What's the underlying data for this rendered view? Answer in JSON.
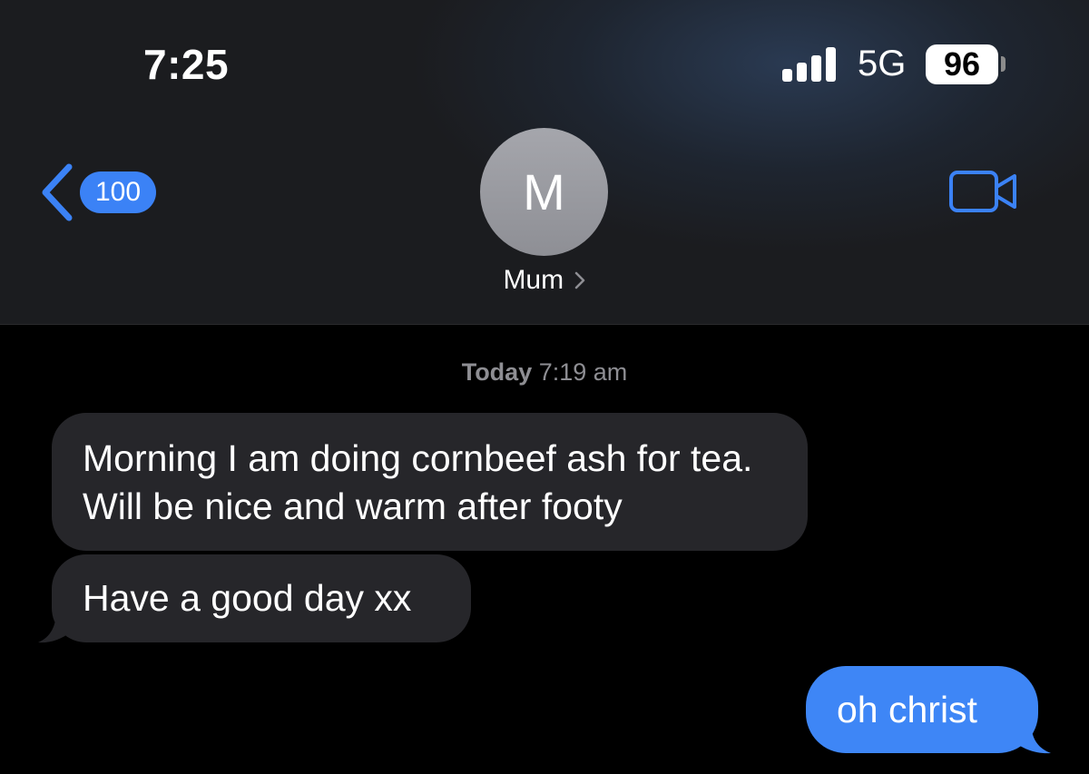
{
  "status_bar": {
    "time": "7:25",
    "network": "5G",
    "battery": "96",
    "signal_icon": "signal-bars-icon",
    "battery_icon": "battery-icon"
  },
  "nav": {
    "back_count": "100",
    "back_icon": "chevron-left-icon",
    "contact_initial": "M",
    "contact_name": "Mum",
    "video_icon": "video-camera-icon"
  },
  "conversation": {
    "timestamp_day": "Today",
    "timestamp_time": "7:19 am",
    "messages": [
      {
        "direction": "incoming",
        "text": "Morning I am doing cornbeef ash for tea.  Will be nice and warm after footy"
      },
      {
        "direction": "incoming",
        "text": "Have a good day xx"
      },
      {
        "direction": "outgoing",
        "text": "oh christ"
      }
    ]
  },
  "colors": {
    "accent": "#3b82f6",
    "outgoing_bubble": "#3e86f6",
    "incoming_bubble": "#26262a",
    "background": "#000000",
    "timestamp_text": "#8e8e93"
  }
}
